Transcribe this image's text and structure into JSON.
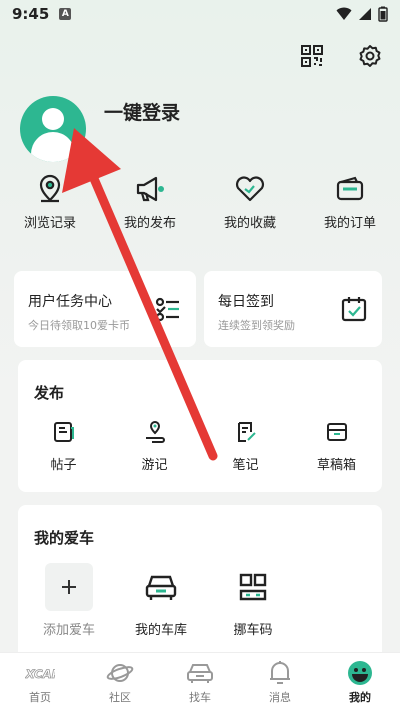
{
  "status_bar": {
    "time": "9:45",
    "badge": "A"
  },
  "header": {
    "icons": [
      "qr-code-icon",
      "settings-icon"
    ]
  },
  "profile": {
    "login_label": "一键登录"
  },
  "quick_actions": [
    {
      "label": "浏览记录",
      "icon": "location-pin-icon"
    },
    {
      "label": "我的发布",
      "icon": "megaphone-icon"
    },
    {
      "label": "我的收藏",
      "icon": "heart-icon"
    },
    {
      "label": "我的订单",
      "icon": "wallet-icon"
    }
  ],
  "task_card": {
    "title": "用户任务中心",
    "subtitle": "今日待领取10爱卡币"
  },
  "sign_card": {
    "title": "每日签到",
    "subtitle": "连续签到领奖励"
  },
  "publish": {
    "title": "发布",
    "items": [
      {
        "label": "帖子",
        "icon": "post-icon"
      },
      {
        "label": "游记",
        "icon": "travel-icon"
      },
      {
        "label": "笔记",
        "icon": "note-icon"
      },
      {
        "label": "草稿箱",
        "icon": "draft-box-icon"
      }
    ]
  },
  "my_car": {
    "title": "我的爱车",
    "items": [
      {
        "label": "添加爱车",
        "icon": "plus-icon"
      },
      {
        "label": "我的车库",
        "icon": "car-icon"
      },
      {
        "label": "挪车码",
        "icon": "qr-code-icon"
      }
    ]
  },
  "tabbar": [
    {
      "label": "首页",
      "icon": "xcar-logo-icon"
    },
    {
      "label": "社区",
      "icon": "planet-icon"
    },
    {
      "label": "找车",
      "icon": "car-icon"
    },
    {
      "label": "消息",
      "icon": "bell-icon"
    },
    {
      "label": "我的",
      "icon": "me-face-icon",
      "active": true
    }
  ],
  "colors": {
    "accent": "#2db791",
    "annotation_arrow": "#e53935"
  }
}
